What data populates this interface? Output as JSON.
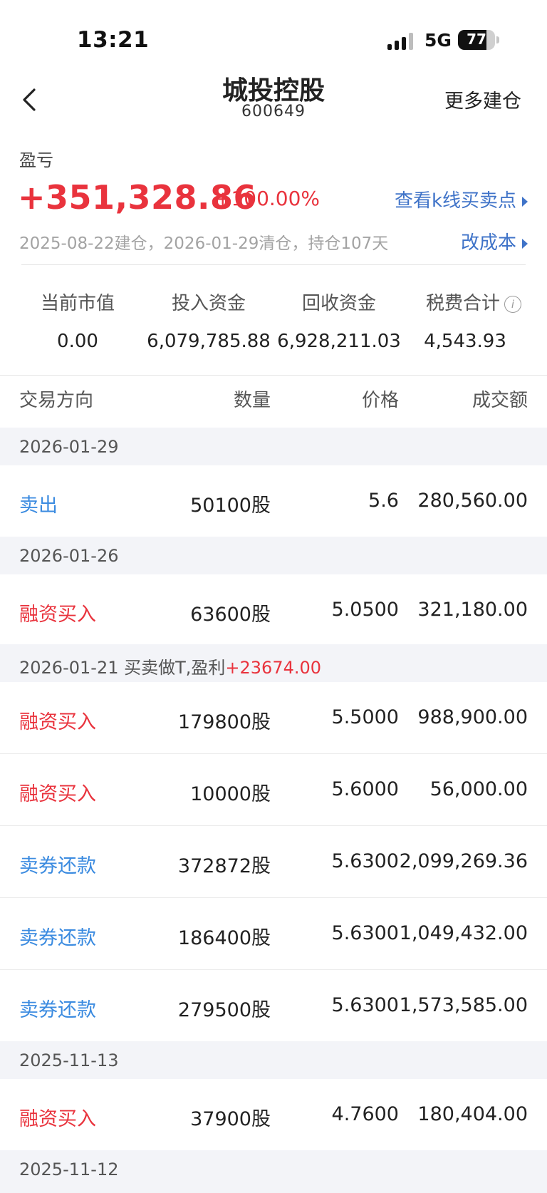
{
  "status_bar": {
    "time": "13:21",
    "network": "5G",
    "battery": "77",
    "battery_level": 0.77
  },
  "header": {
    "title": "城投控股",
    "code": "600649",
    "more_label": "更多建仓"
  },
  "summary": {
    "pl_label": "盈亏",
    "pl_value": "+351,328.86",
    "pl_percent": "+100.00%",
    "kline_link": "查看k线买卖点",
    "meta": "2025-08-22建仓，2026-01-29清仓，持仓107天",
    "cost_link": "改成本"
  },
  "stats": [
    {
      "label": "当前市值",
      "value": "0.00"
    },
    {
      "label": "投入资金",
      "value": "6,079,785.88"
    },
    {
      "label": "回收资金",
      "value": "6,928,211.03"
    },
    {
      "label": "税费合计",
      "value": "4,543.93"
    }
  ],
  "table": {
    "headers": {
      "direction": "交易方向",
      "quantity": "数量",
      "price": "价格",
      "amount": "成交额"
    },
    "groups": [
      {
        "date": "2026-01-29",
        "note": "",
        "profit": "",
        "rows": [
          {
            "direction": "卖出",
            "type": "sell",
            "quantity": "50100股",
            "price": "5.6",
            "amount": "280,560.00"
          }
        ]
      },
      {
        "date": "2026-01-26",
        "note": "",
        "profit": "",
        "rows": [
          {
            "direction": "融资买入",
            "type": "buy",
            "quantity": "63600股",
            "price": "5.0500",
            "amount": "321,180.00"
          }
        ]
      },
      {
        "date": "2026-01-21",
        "note": " 买卖做T,盈利",
        "profit": "+23674.00",
        "rows": [
          {
            "direction": "融资买入",
            "type": "buy",
            "quantity": "179800股",
            "price": "5.5000",
            "amount": "988,900.00"
          },
          {
            "direction": "融资买入",
            "type": "buy",
            "quantity": "10000股",
            "price": "5.6000",
            "amount": "56,000.00"
          },
          {
            "direction": "卖券还款",
            "type": "sell",
            "quantity": "372872股",
            "price": "5.6300",
            "amount": "2,099,269.36"
          },
          {
            "direction": "卖券还款",
            "type": "sell",
            "quantity": "186400股",
            "price": "5.6300",
            "amount": "1,049,432.00"
          },
          {
            "direction": "卖券还款",
            "type": "sell",
            "quantity": "279500股",
            "price": "5.6300",
            "amount": "1,573,585.00"
          }
        ]
      },
      {
        "date": "2025-11-13",
        "note": "",
        "profit": "",
        "rows": [
          {
            "direction": "融资买入",
            "type": "buy",
            "quantity": "37900股",
            "price": "4.7600",
            "amount": "180,404.00"
          }
        ]
      },
      {
        "date": "2025-11-12",
        "note": "",
        "profit": "",
        "rows": []
      }
    ]
  },
  "colors": {
    "red": "#e9333d",
    "blue_sell": "#3b8be0",
    "link_blue": "#3f73c8"
  }
}
